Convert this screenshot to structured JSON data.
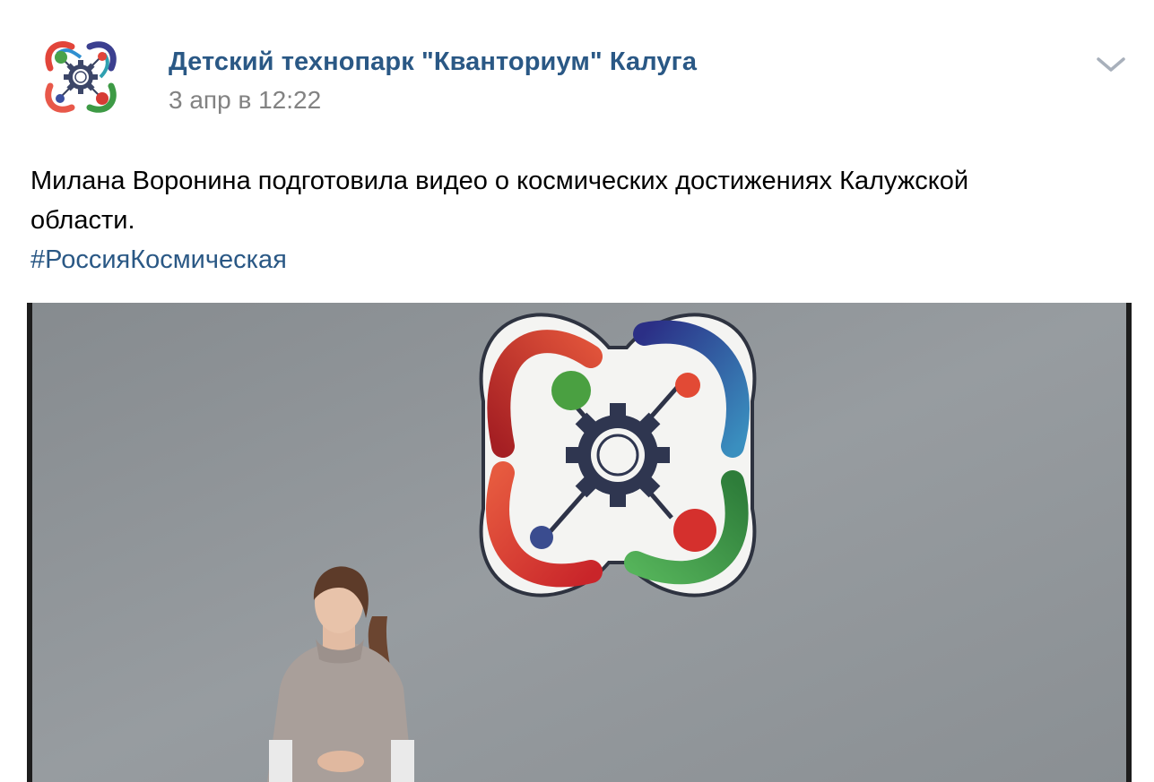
{
  "post": {
    "author": "Детский технопарк \"Кванториум\" Калуга",
    "date": "3 апр в 12:22",
    "text_lines": [
      "Милана Воронина подготовила видео о космических достижениях Калужской",
      "области."
    ],
    "hashtag": "#РоссияКосмическая"
  },
  "icons": {
    "avatar": "kvantorium-logo",
    "menu": "chevron-down-icon"
  },
  "colors": {
    "link": "#2a5885",
    "date": "#828282",
    "text": "#000000"
  }
}
